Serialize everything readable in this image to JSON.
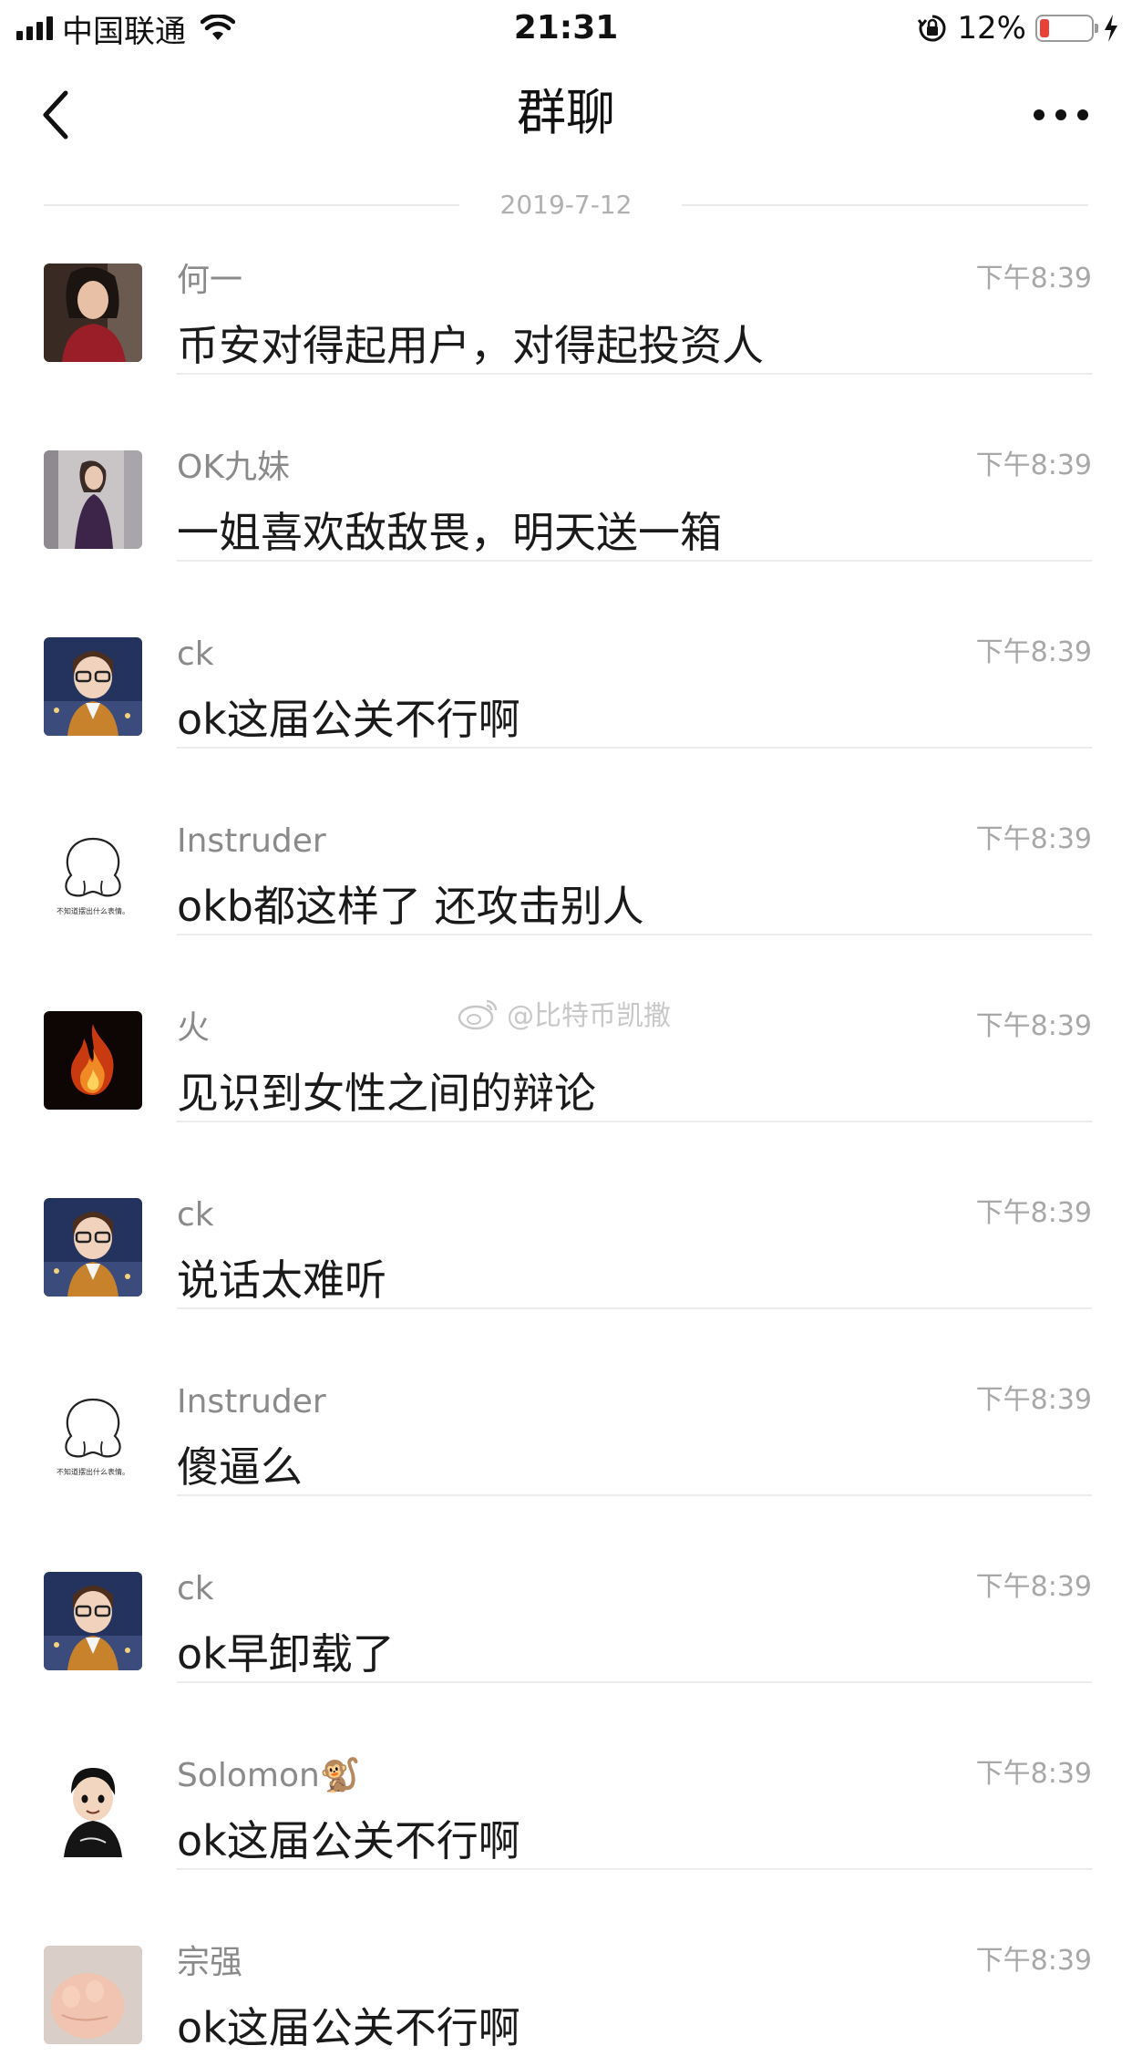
{
  "status_bar": {
    "carrier": "中国联通",
    "time": "21:31",
    "battery_percent": "12%",
    "battery_level": 0.12,
    "battery_color": "#e8413a"
  },
  "nav": {
    "title": "群聊"
  },
  "date_separator": "2019-7-12",
  "watermark": "@比特币凯撒",
  "messages": [
    {
      "name": "何一",
      "time": "下午8:39",
      "text": "币安对得起用户，对得起投资人",
      "avatar": "photo-woman-red"
    },
    {
      "name": "OK九妹",
      "time": "下午8:39",
      "text": "一姐喜欢敌敌畏，明天送一箱",
      "avatar": "photo-woman-dark"
    },
    {
      "name": "ck",
      "time": "下午8:39",
      "text": "ok这届公关不行啊",
      "avatar": "cartoon-man-city"
    },
    {
      "name": "Instruder",
      "time": "下午8:39",
      "text": "okb都这样了 还攻击别人",
      "avatar": "sketch-blob",
      "avatar_caption": "不知道摆出什么表情。"
    },
    {
      "name": "火",
      "time": "下午8:39",
      "text": "见识到女性之间的辩论",
      "avatar": "fire"
    },
    {
      "name": "ck",
      "time": "下午8:39",
      "text": "说话太难听",
      "avatar": "cartoon-man-city"
    },
    {
      "name": "Instruder",
      "time": "下午8:39",
      "text": "傻逼么",
      "avatar": "sketch-blob",
      "avatar_caption": "不知道摆出什么表情。"
    },
    {
      "name": "ck",
      "time": "下午8:39",
      "text": "ok早卸载了",
      "avatar": "cartoon-man-city"
    },
    {
      "name": "Solomon🐒",
      "time": "下午8:39",
      "text": "ok这届公关不行啊",
      "avatar": "cartoon-man-black"
    },
    {
      "name": "宗强",
      "time": "下午8:39",
      "text": "ok这届公关不行啊",
      "avatar": "photo-baby-hand"
    }
  ]
}
